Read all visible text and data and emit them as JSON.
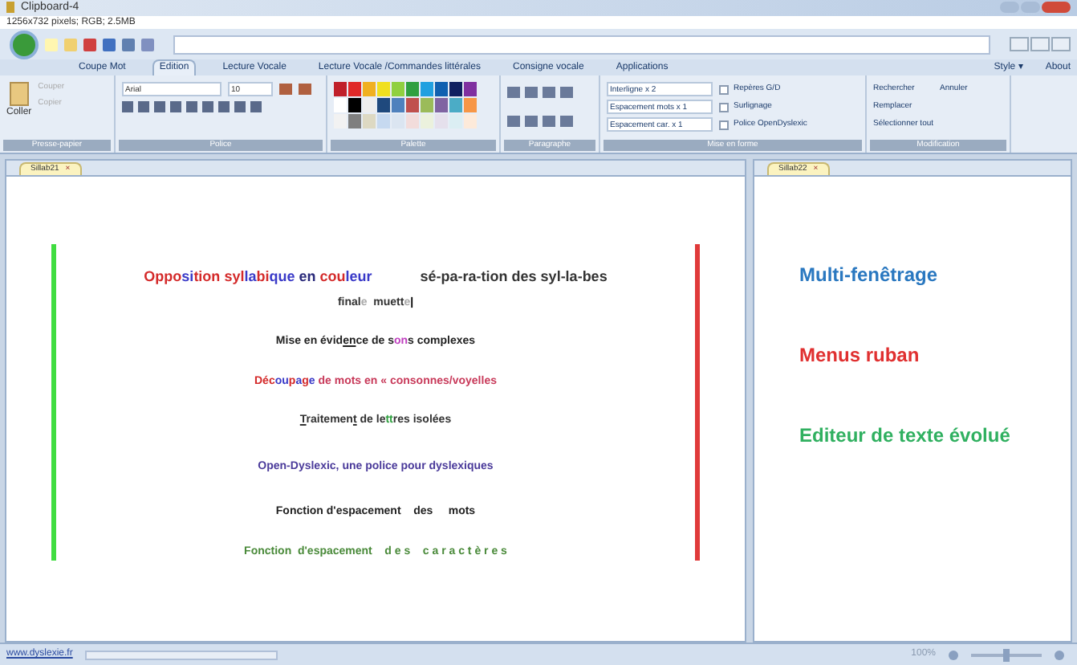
{
  "window": {
    "title": "Clipboard-4"
  },
  "info_line": "1256x732 pixels; RGB; 2.5MB",
  "ribbon_tabs": [
    {
      "label": "Coupe Mot",
      "selected": false
    },
    {
      "label": "Edition",
      "selected": true
    },
    {
      "label": "Lecture Vocale",
      "selected": false
    },
    {
      "label": "Lecture Vocale /Commandes littérales",
      "selected": false
    },
    {
      "label": "Consigne vocale",
      "selected": false
    },
    {
      "label": "Applications",
      "selected": false
    }
  ],
  "ribbon_right": [
    "Style ▾",
    "About"
  ],
  "clipboard": {
    "paste": "Coller",
    "cut": "Couper",
    "copy": "Copier",
    "label": "Presse-papier"
  },
  "font": {
    "family": "Arial",
    "size": "10",
    "label": "Police"
  },
  "palette": {
    "label": "Palette"
  },
  "paragraph": {
    "label": "Paragraphe"
  },
  "format": {
    "label": "Mise en forme",
    "dropdowns": [
      "Interligne x 2",
      "Espacement mots x 1",
      "Espacement car. x 1"
    ],
    "checks": [
      {
        "label": "Repères G/D",
        "checked": false
      },
      {
        "label": "Surlignage",
        "checked": false
      },
      {
        "label": "Police OpenDyslexic",
        "checked": false
      }
    ]
  },
  "modification": {
    "label": "Modification",
    "items": [
      "Rechercher",
      "Remplacer",
      "Sélectionner tout"
    ],
    "undo": "Annuler"
  },
  "left_doc": {
    "tab": "Sillab21",
    "close": "×",
    "lines": [
      [
        {
          "text": "Oppo",
          "color": "#d42a2a"
        },
        {
          "text": "si",
          "color": "#3a3ac8"
        },
        {
          "text": "tion ",
          "color": "#d42a2a"
        },
        {
          "text": "syl",
          "color": "#d42a2a"
        },
        {
          "text": "la",
          "color": "#3a3ac8"
        },
        {
          "text": "bi",
          "color": "#d42a2a"
        },
        {
          "text": "que",
          "color": "#3a3ac8"
        },
        {
          "text": " en ",
          "color": "#2a2a7a"
        },
        {
          "text": "cou",
          "color": "#d42a2a"
        },
        {
          "text": "leur",
          "color": "#3a3ac8"
        },
        {
          "text": "            sé-pa-ra-tion des syl-la-bes",
          "color": "#333333"
        }
      ],
      [
        {
          "text": "final",
          "color": "#333333"
        },
        {
          "text": "e",
          "color": "#aaaaaa"
        },
        {
          "text": "  muett",
          "color": "#333333"
        },
        {
          "text": "e",
          "color": "#aaaaaa"
        },
        {
          "text": "|",
          "color": "#000000"
        }
      ],
      [
        {
          "text": "Mise en évid",
          "color": "#222222"
        },
        {
          "text": "en",
          "color": "#222222",
          "underline": true
        },
        {
          "text": "ce de s",
          "color": "#222222"
        },
        {
          "text": "on",
          "color": "#c040c0"
        },
        {
          "text": "s complexes",
          "color": "#222222"
        }
      ],
      [
        {
          "text": "Déc",
          "color": "#d42a2a"
        },
        {
          "text": "ou",
          "color": "#3a3ac8"
        },
        {
          "text": "p",
          "color": "#d42a2a"
        },
        {
          "text": "a",
          "color": "#3a3ac8"
        },
        {
          "text": "g",
          "color": "#d42a2a"
        },
        {
          "text": "e",
          "color": "#3a3ac8"
        },
        {
          "text": " de mots en « consonnes/voyelles",
          "color": "#c83a5a"
        }
      ],
      [
        {
          "text": "T",
          "color": "#333333",
          "underline": true
        },
        {
          "text": "raitemen",
          "color": "#333333"
        },
        {
          "text": "t",
          "color": "#333333",
          "underline": true
        },
        {
          "text": " de le",
          "color": "#333333"
        },
        {
          "text": "tt",
          "color": "#30a040"
        },
        {
          "text": "res isolées",
          "color": "#333333"
        }
      ],
      [
        {
          "text": "Open-Dyslexic, une police pour dyslexiques",
          "color": "#4a3a9a"
        }
      ],
      [
        {
          "text": "Fonction d'espacement    des     mots",
          "color": "#222222"
        }
      ],
      [
        {
          "text": "Fonction  d'espacement    d e s    c a r a c t è r e s",
          "color": "#4a8a3a"
        }
      ]
    ]
  },
  "right_doc": {
    "tab": "Sillab22",
    "close": "×",
    "lines": [
      {
        "text": "Multi-fenêtrage",
        "color": "#2a78c0"
      },
      {
        "text": "Menus ruban",
        "color": "#e03030"
      },
      {
        "text": "Editeur de texte évolué",
        "color": "#30b060"
      }
    ]
  },
  "status_bar": {
    "link": "www.dyslexie.fr",
    "zoom": "100%",
    "zoom_slider": {
      "level": 0.5
    }
  }
}
